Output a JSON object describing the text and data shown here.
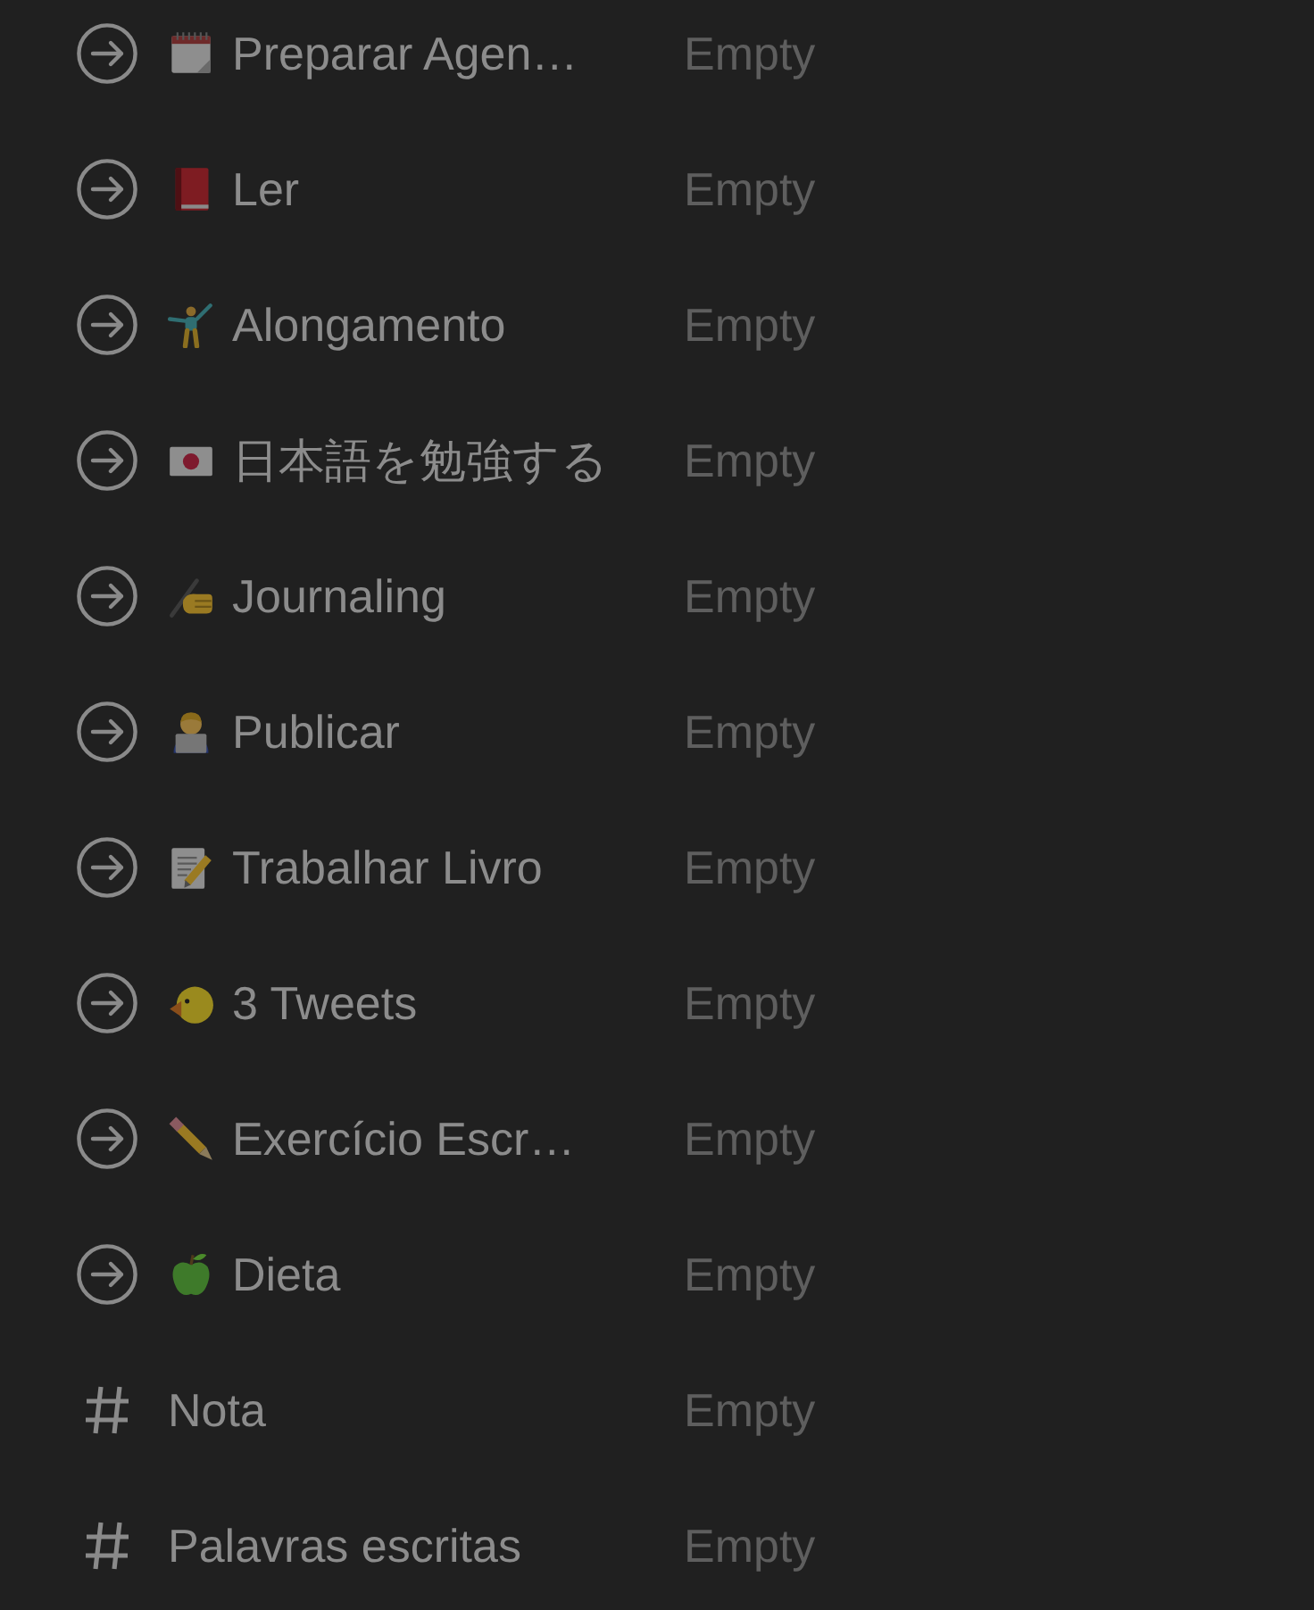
{
  "properties": [
    {
      "kind": "relation",
      "name": "Preparar Agen…",
      "placeholder": "Empty"
    },
    {
      "kind": "relation",
      "name": "Ler",
      "placeholder": "Empty"
    },
    {
      "kind": "relation",
      "name": "Alongamento",
      "placeholder": "Empty"
    },
    {
      "kind": "relation",
      "name": "日本語を勉強する",
      "placeholder": "Empty"
    },
    {
      "kind": "relation",
      "name": "Journaling",
      "placeholder": "Empty"
    },
    {
      "kind": "relation",
      "name": "Publicar",
      "placeholder": "Empty"
    },
    {
      "kind": "relation",
      "name": "Trabalhar Livro",
      "placeholder": "Empty"
    },
    {
      "kind": "relation",
      "name": "3 Tweets",
      "placeholder": "Empty"
    },
    {
      "kind": "relation",
      "name": "Exercício Escr…",
      "placeholder": "Empty"
    },
    {
      "kind": "relation",
      "name": "Dieta",
      "placeholder": "Empty"
    },
    {
      "kind": "number",
      "name": "Nota",
      "placeholder": "Empty"
    },
    {
      "kind": "number",
      "name": "Palavras escritas",
      "placeholder": "Empty"
    }
  ]
}
